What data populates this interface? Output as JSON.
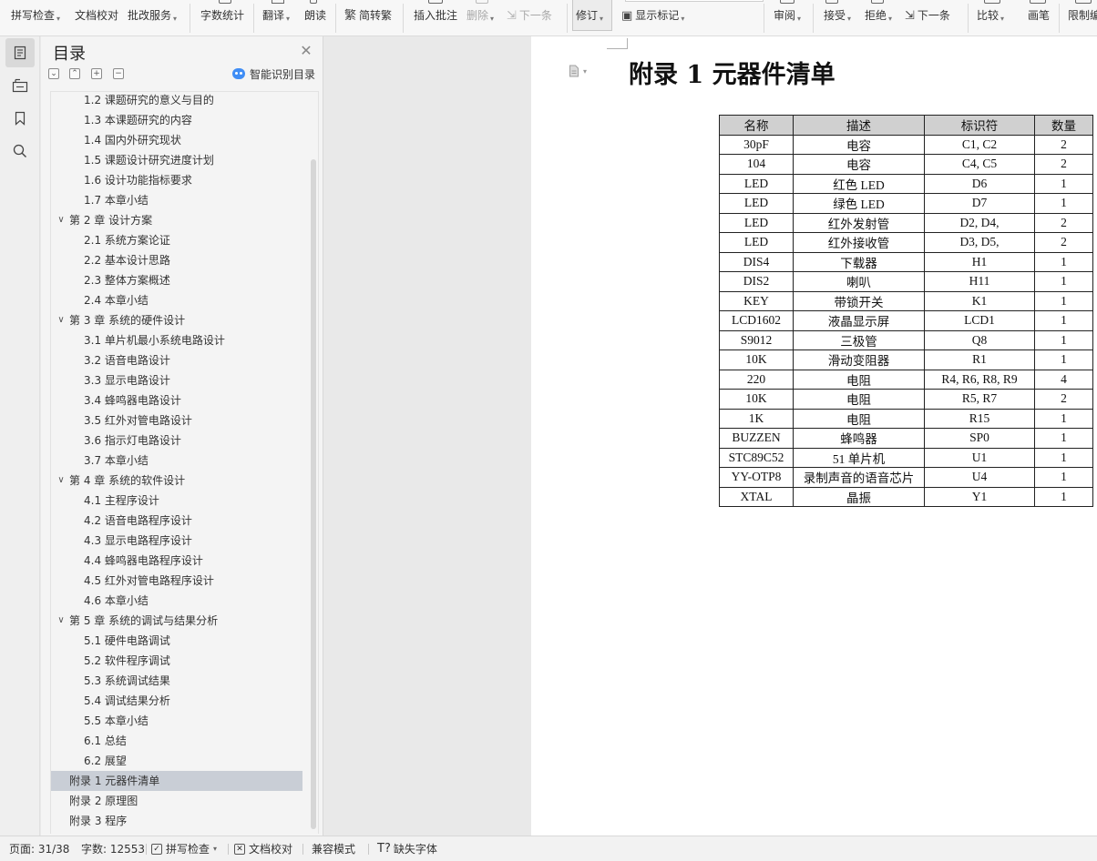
{
  "toolbar": {
    "spell_check": "拼写检查",
    "doc_proof": "文档校对",
    "batch_service": "批改服务",
    "word_count": "字数统计",
    "translate": "翻译",
    "read_aloud": "朗读",
    "simp_trad": "简转繁",
    "insert_comment": "插入批注",
    "delete": "删除",
    "next_item_disabled": "下一条",
    "revise": "修订",
    "show_markup": "显示标记",
    "review": "审阅",
    "accept": "接受",
    "reject": "拒绝",
    "next_item": "下一条",
    "compare": "比较",
    "pen": "画笔",
    "restrict_edit": "限制编"
  },
  "toc": {
    "title": "目录",
    "smart_label": "智能识别目录",
    "items": [
      {
        "text": "1.2 课题研究的意义与目的",
        "level": 2
      },
      {
        "text": "1.3 本课题研究的内容",
        "level": 2
      },
      {
        "text": "1.4 国内外研究现状",
        "level": 2
      },
      {
        "text": "1.5 课题设计研究进度计划",
        "level": 2
      },
      {
        "text": "1.6 设计功能指标要求",
        "level": 2
      },
      {
        "text": "1.7  本章小结",
        "level": 2
      },
      {
        "text": "第 2 章  设计方案",
        "level": 1
      },
      {
        "text": "2.1  系统方案论证",
        "level": 2
      },
      {
        "text": "2.2  基本设计思路",
        "level": 2
      },
      {
        "text": "2.3  整体方案概述",
        "level": 2
      },
      {
        "text": "2.4  本章小结",
        "level": 2
      },
      {
        "text": "第 3 章  系统的硬件设计",
        "level": 1
      },
      {
        "text": "3.1 单片机最小系统电路设计",
        "level": 2
      },
      {
        "text": "3.2  语音电路设计",
        "level": 2
      },
      {
        "text": "3.3  显示电路设计",
        "level": 2
      },
      {
        "text": "3.4  蜂鸣器电路设计",
        "level": 2
      },
      {
        "text": "3.5  红外对管电路设计",
        "level": 2
      },
      {
        "text": "3.6  指示灯电路设计",
        "level": 2
      },
      {
        "text": "3.7  本章小结",
        "level": 2
      },
      {
        "text": "第 4 章  系统的软件设计",
        "level": 1
      },
      {
        "text": "4.1 主程序设计",
        "level": 2
      },
      {
        "text": "4.2  语音电路程序设计",
        "level": 2
      },
      {
        "text": "4.3  显示电路程序设计",
        "level": 2
      },
      {
        "text": "4.4  蜂鸣器电路程序设计",
        "level": 2
      },
      {
        "text": "4.5  红外对管电路程序设计",
        "level": 2
      },
      {
        "text": "4.6  本章小结",
        "level": 2
      },
      {
        "text": "第 5 章  系统的调试与结果分析",
        "level": 1
      },
      {
        "text": "5.1  硬件电路调试",
        "level": 2
      },
      {
        "text": "5.2  软件程序调试",
        "level": 2
      },
      {
        "text": "5.3 系统调试结果",
        "level": 2
      },
      {
        "text": "5.4  调试结果分析",
        "level": 2
      },
      {
        "text": "5.5  本章小结",
        "level": 2
      },
      {
        "text": "6.1  总结",
        "level": 2
      },
      {
        "text": "6.2  展望",
        "level": 2
      },
      {
        "text": "附录 1 元器件清单",
        "level": 0,
        "selected": true
      },
      {
        "text": "附录 2  原理图",
        "level": 0
      },
      {
        "text": "附录 3 程序",
        "level": 0
      }
    ]
  },
  "document": {
    "title": "附录 1 元器件清单",
    "table": {
      "headers": [
        "名称",
        "描述",
        "标识符",
        "数量"
      ],
      "rows": [
        [
          "30pF",
          "电容",
          "C1, C2",
          "2"
        ],
        [
          "104",
          "电容",
          "C4, C5",
          "2"
        ],
        [
          "LED",
          "红色 LED",
          "D6",
          "1"
        ],
        [
          "LED",
          "绿色 LED",
          "D7",
          "1"
        ],
        [
          "LED",
          "红外发射管",
          "D2, D4,",
          "2"
        ],
        [
          "LED",
          "红外接收管",
          "D3, D5,",
          "2"
        ],
        [
          "DIS4",
          "下载器",
          "H1",
          "1"
        ],
        [
          "DIS2",
          "喇叭",
          "H11",
          "1"
        ],
        [
          "KEY",
          "带锁开关",
          "K1",
          "1"
        ],
        [
          "LCD1602",
          "液晶显示屏",
          "LCD1",
          "1"
        ],
        [
          "S9012",
          "三极管",
          "Q8",
          "1"
        ],
        [
          "10K",
          "滑动变阻器",
          "R1",
          "1"
        ],
        [
          "220",
          "电阻",
          "R4, R6, R8, R9",
          "4"
        ],
        [
          "10K",
          "电阻",
          "R5, R7",
          "2"
        ],
        [
          "1K",
          "电阻",
          "R15",
          "1"
        ],
        [
          "BUZZEN",
          "蜂鸣器",
          "SP0",
          "1"
        ],
        [
          "STC89C52",
          "51 单片机",
          "U1",
          "1"
        ],
        [
          "YY-OTP8",
          "录制声音的语音芯片",
          "U4",
          "1"
        ],
        [
          "XTAL",
          "晶振",
          "Y1",
          "1"
        ]
      ]
    }
  },
  "status": {
    "page": "页面: 31/38",
    "words": "字数: 12553",
    "spell_check": "拼写检查",
    "doc_proof": "文档校对",
    "compat_mode": "兼容模式",
    "missing_fonts": "缺失字体"
  },
  "icons": {
    "rail": [
      "toc-icon",
      "navigation-icon",
      "bookmark-icon",
      "search-icon"
    ],
    "toc_controls": [
      "collapse-all-icon",
      "expand-up-icon",
      "add-level-icon",
      "remove-level-icon"
    ]
  }
}
